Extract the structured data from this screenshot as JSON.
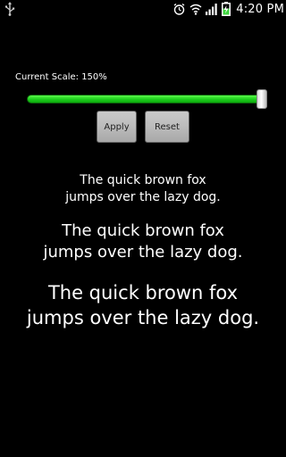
{
  "status_bar": {
    "time": "4:20 PM",
    "battery_level": 0.6,
    "icons": [
      "usb-icon",
      "alarm-icon",
      "wifi-icon",
      "signal-icon",
      "battery-charging-icon"
    ]
  },
  "scale": {
    "label": "Current Scale: 150%",
    "slider_value": 1.0
  },
  "buttons": {
    "apply_label": "Apply",
    "reset_label": "Reset"
  },
  "previews": [
    {
      "line1": "The quick brown fox",
      "line2": "jumps over the lazy dog."
    },
    {
      "line1": "The quick brown fox",
      "line2": "jumps over the lazy dog."
    },
    {
      "line1": "The quick brown fox",
      "line2": "jumps over the lazy dog."
    }
  ],
  "colors": {
    "background": "#000000",
    "slider_fill": "#1fd21f",
    "text": "#ffffff",
    "button": "#bdbdbd"
  }
}
